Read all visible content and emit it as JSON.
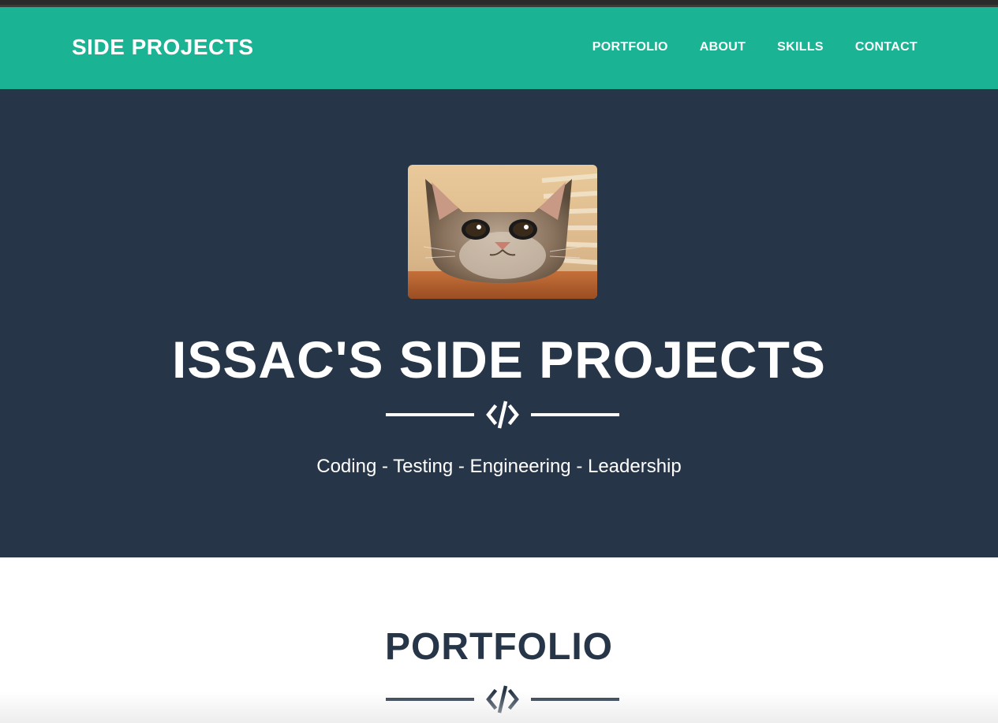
{
  "navbar": {
    "brand": "SIDE PROJECTS",
    "links": [
      "PORTFOLIO",
      "ABOUT",
      "SKILLS",
      "CONTACT"
    ]
  },
  "masthead": {
    "avatar_alt": "cat peeking over table",
    "title": "ISSAC'S SIDE PROJECTS",
    "divider_icon": "code-icon",
    "tagline": "Coding - Testing - Engineering - Leadership"
  },
  "portfolio": {
    "title": "PORTFOLIO",
    "divider_icon": "code-icon"
  },
  "colors": {
    "nav_bg": "#1ab394",
    "masthead_bg": "#263547",
    "text_light": "#ffffff",
    "text_dark": "#263547"
  }
}
